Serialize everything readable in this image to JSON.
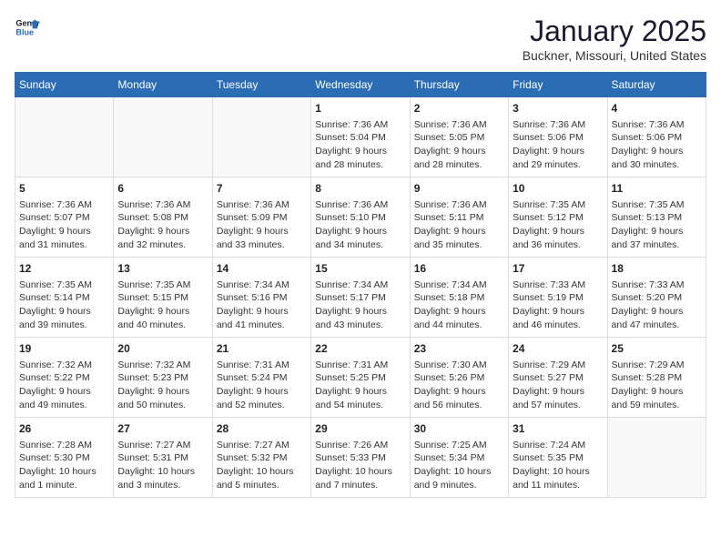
{
  "logo": {
    "text_general": "General",
    "text_blue": "Blue"
  },
  "title": "January 2025",
  "subtitle": "Buckner, Missouri, United States",
  "days_header": [
    "Sunday",
    "Monday",
    "Tuesday",
    "Wednesday",
    "Thursday",
    "Friday",
    "Saturday"
  ],
  "weeks": [
    [
      {
        "day": "",
        "info": ""
      },
      {
        "day": "",
        "info": ""
      },
      {
        "day": "",
        "info": ""
      },
      {
        "day": "1",
        "info": "Sunrise: 7:36 AM\nSunset: 5:04 PM\nDaylight: 9 hours\nand 28 minutes."
      },
      {
        "day": "2",
        "info": "Sunrise: 7:36 AM\nSunset: 5:05 PM\nDaylight: 9 hours\nand 28 minutes."
      },
      {
        "day": "3",
        "info": "Sunrise: 7:36 AM\nSunset: 5:06 PM\nDaylight: 9 hours\nand 29 minutes."
      },
      {
        "day": "4",
        "info": "Sunrise: 7:36 AM\nSunset: 5:06 PM\nDaylight: 9 hours\nand 30 minutes."
      }
    ],
    [
      {
        "day": "5",
        "info": "Sunrise: 7:36 AM\nSunset: 5:07 PM\nDaylight: 9 hours\nand 31 minutes."
      },
      {
        "day": "6",
        "info": "Sunrise: 7:36 AM\nSunset: 5:08 PM\nDaylight: 9 hours\nand 32 minutes."
      },
      {
        "day": "7",
        "info": "Sunrise: 7:36 AM\nSunset: 5:09 PM\nDaylight: 9 hours\nand 33 minutes."
      },
      {
        "day": "8",
        "info": "Sunrise: 7:36 AM\nSunset: 5:10 PM\nDaylight: 9 hours\nand 34 minutes."
      },
      {
        "day": "9",
        "info": "Sunrise: 7:36 AM\nSunset: 5:11 PM\nDaylight: 9 hours\nand 35 minutes."
      },
      {
        "day": "10",
        "info": "Sunrise: 7:35 AM\nSunset: 5:12 PM\nDaylight: 9 hours\nand 36 minutes."
      },
      {
        "day": "11",
        "info": "Sunrise: 7:35 AM\nSunset: 5:13 PM\nDaylight: 9 hours\nand 37 minutes."
      }
    ],
    [
      {
        "day": "12",
        "info": "Sunrise: 7:35 AM\nSunset: 5:14 PM\nDaylight: 9 hours\nand 39 minutes."
      },
      {
        "day": "13",
        "info": "Sunrise: 7:35 AM\nSunset: 5:15 PM\nDaylight: 9 hours\nand 40 minutes."
      },
      {
        "day": "14",
        "info": "Sunrise: 7:34 AM\nSunset: 5:16 PM\nDaylight: 9 hours\nand 41 minutes."
      },
      {
        "day": "15",
        "info": "Sunrise: 7:34 AM\nSunset: 5:17 PM\nDaylight: 9 hours\nand 43 minutes."
      },
      {
        "day": "16",
        "info": "Sunrise: 7:34 AM\nSunset: 5:18 PM\nDaylight: 9 hours\nand 44 minutes."
      },
      {
        "day": "17",
        "info": "Sunrise: 7:33 AM\nSunset: 5:19 PM\nDaylight: 9 hours\nand 46 minutes."
      },
      {
        "day": "18",
        "info": "Sunrise: 7:33 AM\nSunset: 5:20 PM\nDaylight: 9 hours\nand 47 minutes."
      }
    ],
    [
      {
        "day": "19",
        "info": "Sunrise: 7:32 AM\nSunset: 5:22 PM\nDaylight: 9 hours\nand 49 minutes."
      },
      {
        "day": "20",
        "info": "Sunrise: 7:32 AM\nSunset: 5:23 PM\nDaylight: 9 hours\nand 50 minutes."
      },
      {
        "day": "21",
        "info": "Sunrise: 7:31 AM\nSunset: 5:24 PM\nDaylight: 9 hours\nand 52 minutes."
      },
      {
        "day": "22",
        "info": "Sunrise: 7:31 AM\nSunset: 5:25 PM\nDaylight: 9 hours\nand 54 minutes."
      },
      {
        "day": "23",
        "info": "Sunrise: 7:30 AM\nSunset: 5:26 PM\nDaylight: 9 hours\nand 56 minutes."
      },
      {
        "day": "24",
        "info": "Sunrise: 7:29 AM\nSunset: 5:27 PM\nDaylight: 9 hours\nand 57 minutes."
      },
      {
        "day": "25",
        "info": "Sunrise: 7:29 AM\nSunset: 5:28 PM\nDaylight: 9 hours\nand 59 minutes."
      }
    ],
    [
      {
        "day": "26",
        "info": "Sunrise: 7:28 AM\nSunset: 5:30 PM\nDaylight: 10 hours\nand 1 minute."
      },
      {
        "day": "27",
        "info": "Sunrise: 7:27 AM\nSunset: 5:31 PM\nDaylight: 10 hours\nand 3 minutes."
      },
      {
        "day": "28",
        "info": "Sunrise: 7:27 AM\nSunset: 5:32 PM\nDaylight: 10 hours\nand 5 minutes."
      },
      {
        "day": "29",
        "info": "Sunrise: 7:26 AM\nSunset: 5:33 PM\nDaylight: 10 hours\nand 7 minutes."
      },
      {
        "day": "30",
        "info": "Sunrise: 7:25 AM\nSunset: 5:34 PM\nDaylight: 10 hours\nand 9 minutes."
      },
      {
        "day": "31",
        "info": "Sunrise: 7:24 AM\nSunset: 5:35 PM\nDaylight: 10 hours\nand 11 minutes."
      },
      {
        "day": "",
        "info": ""
      }
    ]
  ]
}
